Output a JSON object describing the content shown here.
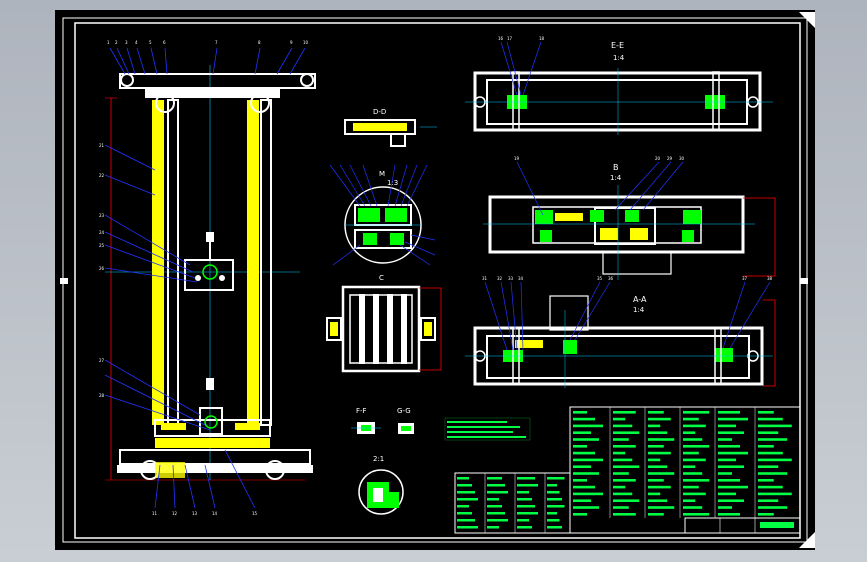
{
  "sheet": {
    "background": "#000000",
    "frame_color": "#ffffff"
  },
  "colors": {
    "outline": "#ffffff",
    "member": "#ffff00",
    "leader": "#2233ff",
    "centerline": "#00ccff",
    "hatch": "#00ff00",
    "dimension": "#ff0000",
    "table_text": "#00ff44"
  },
  "views": {
    "section_dd": {
      "title": "D-D"
    },
    "detail_m": {
      "title": "M",
      "scale": "1:3"
    },
    "view_c": {
      "title": "C"
    },
    "section_ee": {
      "title": "E-E",
      "scale": "1:4"
    },
    "view_b": {
      "title": "B",
      "scale": "1:4"
    },
    "section_aa": {
      "title": "A-A",
      "scale": "1:4"
    },
    "section_ff": {
      "title": "F-F"
    },
    "section_gg": {
      "title": "G-G"
    },
    "detail_2": {
      "title": "2:1"
    }
  },
  "balloons": {
    "frame_top": [
      "1",
      "2",
      "3",
      "4",
      "5",
      "6",
      "7",
      "8",
      "9",
      "10"
    ],
    "frame_left": [
      "21",
      "22",
      "23",
      "24",
      "25",
      "26",
      "27",
      "28"
    ],
    "frame_bottom": [
      "11",
      "12",
      "13",
      "14",
      "15"
    ],
    "section_ee": [
      "16",
      "17",
      "18"
    ],
    "view_b": [
      "19",
      "20",
      "29",
      "30"
    ],
    "section_aa": [
      "31",
      "32",
      "33",
      "34",
      "35",
      "36",
      "37",
      "38"
    ]
  },
  "icons": {
    "title_block": "title-block-icon",
    "parts_list": "parts-list-icon",
    "tech_notes": "tech-notes-icon"
  }
}
